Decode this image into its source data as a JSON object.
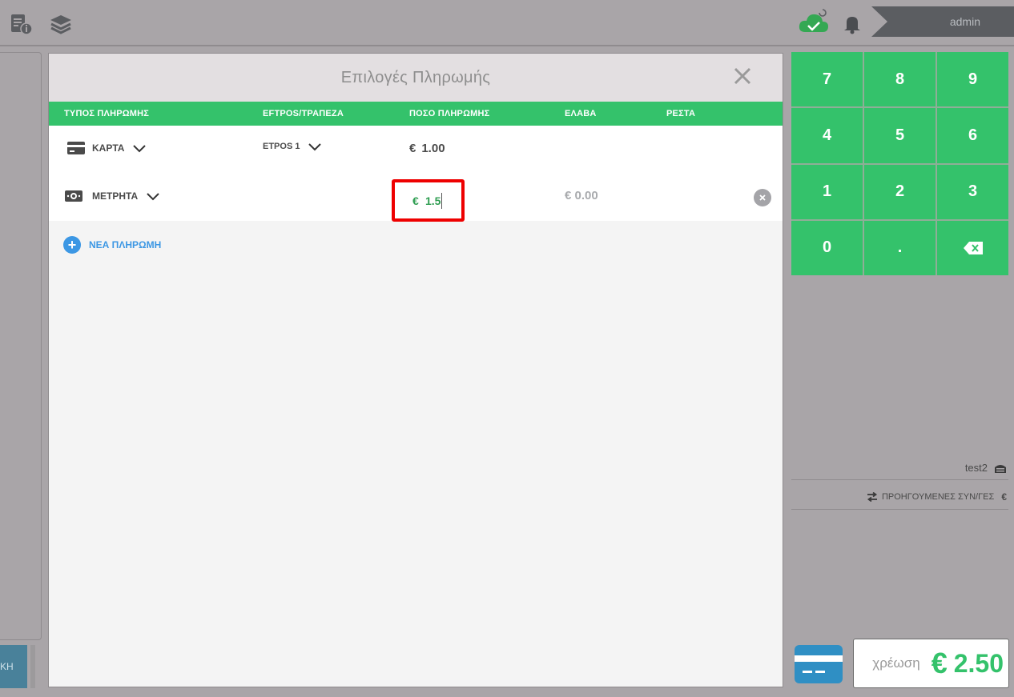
{
  "topbar": {
    "user": "admin"
  },
  "sidebar_left": {
    "button_label": "ΚΗ"
  },
  "modal": {
    "title": "Επιλογές Πληρωμής",
    "columns": [
      "ΤΥΠΟΣ ΠΛΗΡΩΜΗΣ",
      "EFTPOS/ΤΡΑΠΕΖΑ",
      "ΠΟΣΟ ΠΛΗΡΩΜΗΣ",
      "ΕΛΑΒΑ",
      "ΡΕΣΤΑ"
    ],
    "rows": [
      {
        "type": "ΚΑΡΤΑ",
        "bank": "ETPOS 1",
        "currency": "€",
        "amount": "1.00"
      },
      {
        "type": "ΜΕΤΡΗΤΑ",
        "currency": "€",
        "amount": "1.5",
        "received": "€ 0.00"
      }
    ],
    "new_payment": "ΝΕΑ ΠΛΗΡΩΜΗ"
  },
  "keypad": {
    "keys": [
      "7",
      "8",
      "9",
      "4",
      "5",
      "6",
      "1",
      "2",
      "3",
      "0",
      "."
    ]
  },
  "right_panel": {
    "table_name": "test2",
    "previous_transactions": "ΠΡΟΗΓΟΥΜΕΝΕΣ ΣΥΝ/ΓΕΣ",
    "previous_suffix": "€"
  },
  "charge": {
    "label": "χρέωση",
    "currency": "€",
    "amount": "2.50"
  },
  "colors": {
    "accent_green": "#34c26b",
    "highlight_red": "#ee0000",
    "link_blue": "#3c97e4"
  }
}
